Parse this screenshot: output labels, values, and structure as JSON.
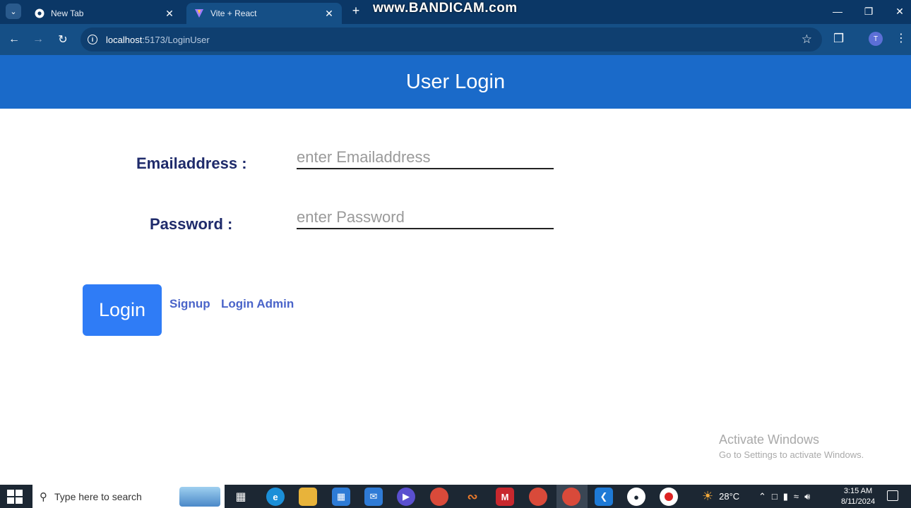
{
  "browser": {
    "tabs": [
      {
        "title": "New Tab",
        "favicon": "chrome-icon"
      },
      {
        "title": "Vite + React",
        "favicon": "vite-icon",
        "active": true
      }
    ],
    "watermark": "www.BANDICAM.com",
    "url_host": "localhost",
    "url_path": ":5173/LoginUser",
    "profile_initial": "T"
  },
  "page": {
    "title": "User Login",
    "email_label": "Emailaddress :",
    "email_placeholder": "enter Emailaddress",
    "email_value": "",
    "password_label": "Password :",
    "password_placeholder": "enter Password",
    "password_value": "",
    "login_button": "Login",
    "signup_link": "Signup",
    "login_admin_link": "Login Admin"
  },
  "watermark_windows": {
    "line1": "Activate Windows",
    "line2": "Go to Settings to activate Windows."
  },
  "taskbar": {
    "search_placeholder": "Type here to search",
    "temperature": "28°C",
    "time": "3:15 AM",
    "date": "8/11/2024"
  },
  "colors": {
    "header_bg": "#1a6ac9",
    "label_text": "#1f2b6b",
    "button_bg": "#2f7cf6",
    "link": "#4a64c9"
  }
}
